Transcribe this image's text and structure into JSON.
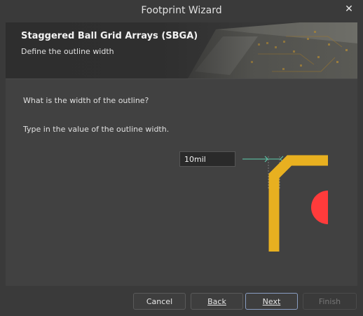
{
  "window": {
    "title": "Footprint Wizard",
    "close_icon": "close-icon"
  },
  "banner": {
    "title": "Staggered Ball Grid Arrays (SBGA)",
    "subtitle": "Define the outline width"
  },
  "content": {
    "question": "What is the width of the outline?",
    "instruction": "Type in the value of the outline width.",
    "outline_width_value": "10mil"
  },
  "diagram": {
    "outline_color": "#e8b020",
    "pad_color": "#ff3b3b",
    "dimension_line_color": "#5fd0b0"
  },
  "buttons": {
    "cancel": "Cancel",
    "back": "Back",
    "next": "Next",
    "finish": "Finish"
  }
}
